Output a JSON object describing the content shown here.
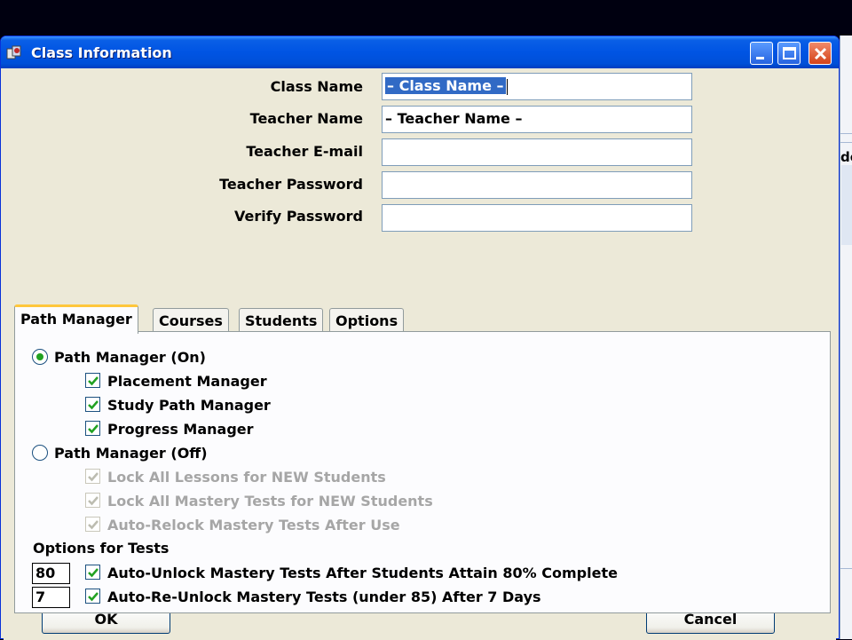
{
  "window": {
    "title": "Class Information"
  },
  "form": {
    "class_name_label": "Class Name",
    "class_name_value": "– Class Name –",
    "teacher_name_label": "Teacher Name",
    "teacher_name_value": "– Teacher Name –",
    "teacher_email_label": "Teacher E-mail",
    "teacher_email_value": "",
    "teacher_password_label": "Teacher Password",
    "teacher_password_value": "",
    "verify_password_label": "Verify Password",
    "verify_password_value": ""
  },
  "tabs": [
    "Path Manager",
    "Courses",
    "Students",
    "Options"
  ],
  "path_manager": {
    "on_label": "Path Manager (On)",
    "on_selected": true,
    "on_options": [
      {
        "label": "Placement Manager",
        "checked": true
      },
      {
        "label": "Study Path Manager",
        "checked": true
      },
      {
        "label": "Progress Manager",
        "checked": true
      }
    ],
    "off_label": "Path Manager (Off)",
    "off_selected": false,
    "off_options": [
      {
        "label": "Lock All Lessons for NEW Students",
        "checked": true
      },
      {
        "label": "Lock All Mastery Tests for NEW Students",
        "checked": true
      },
      {
        "label": "Auto-Relock Mastery Tests After Use",
        "checked": true
      }
    ]
  },
  "tests": {
    "heading": "Options for Tests",
    "unlock_value": "80",
    "unlock_label": "Auto-Unlock Mastery Tests After Students Attain 80% Complete",
    "reunlock_value": "7",
    "reunlock_label": "Auto-Re-Unlock Mastery Tests (under 85) After 7 Days"
  },
  "buttons": {
    "ok": "OK",
    "cancel": "Cancel"
  },
  "background": {
    "partial_text": "de"
  },
  "colors": {
    "titlebar": "#0054e3",
    "window_bg": "#ece9d8",
    "selection": "#316ac5",
    "radio_dot": "#21a121"
  }
}
